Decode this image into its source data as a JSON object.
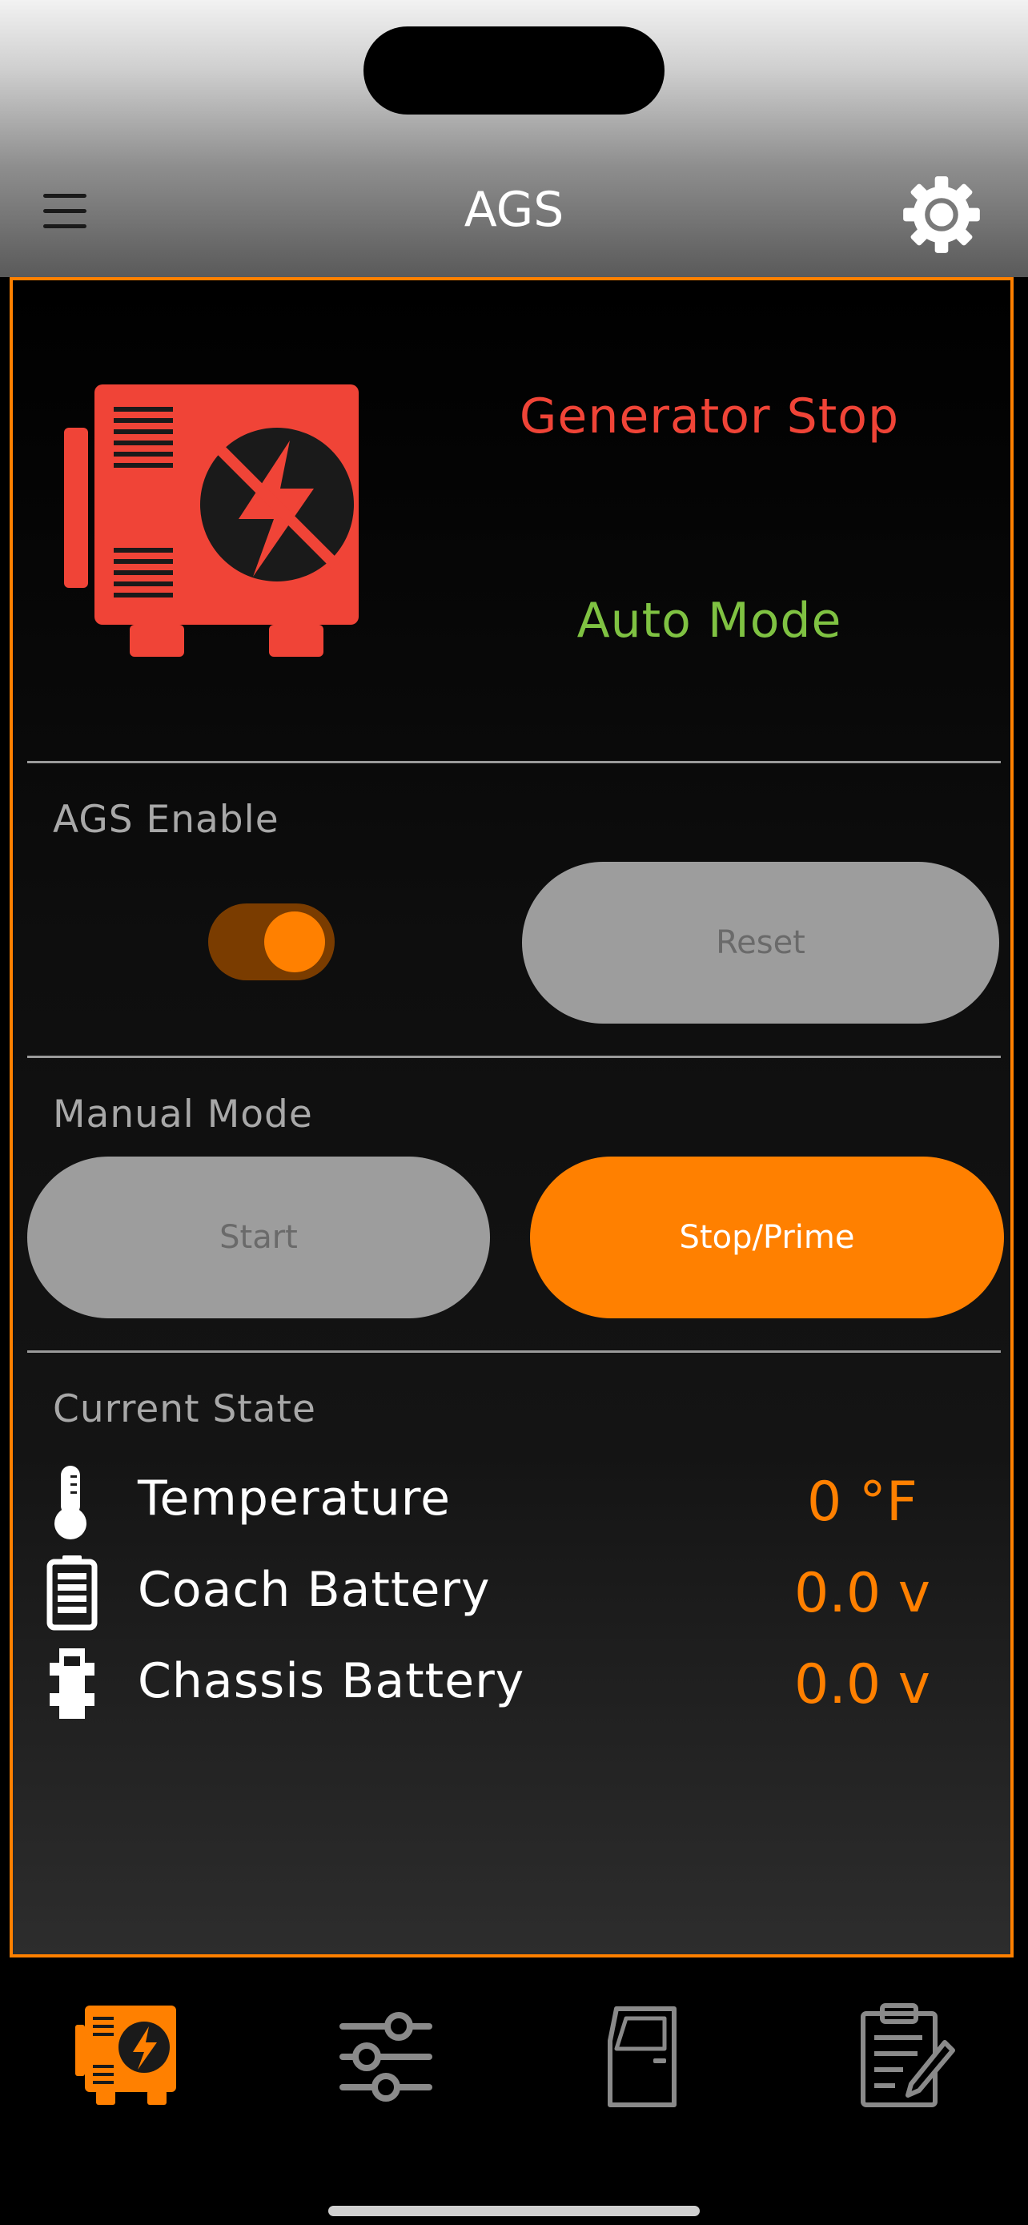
{
  "header": {
    "title": "AGS",
    "menu_icon": "hamburger-menu-icon",
    "settings_icon": "gear-icon"
  },
  "generator": {
    "status": "Generator Stop",
    "status_color": "#f04437",
    "mode": "Auto Mode",
    "mode_color": "#7fc242"
  },
  "ags_enable": {
    "label": "AGS Enable",
    "toggle_on": true,
    "reset_label": "Reset"
  },
  "manual_mode": {
    "label": "Manual Mode",
    "start_label": "Start",
    "stop_label": "Stop/Prime"
  },
  "current_state": {
    "label": "Current State",
    "rows": [
      {
        "icon": "thermometer-icon",
        "label": "Temperature",
        "value": "0 °F"
      },
      {
        "icon": "battery-icon",
        "label": "Coach Battery",
        "value": "0.0 v"
      },
      {
        "icon": "chassis-icon",
        "label": "Chassis Battery",
        "value": "0.0 v"
      }
    ]
  },
  "tabs": [
    {
      "icon": "generator-tab-icon",
      "active": true
    },
    {
      "icon": "sliders-icon",
      "active": false
    },
    {
      "icon": "door-icon",
      "active": false
    },
    {
      "icon": "clipboard-edit-icon",
      "active": false
    }
  ],
  "colors": {
    "accent": "#ff8000",
    "panel_border": "#ff8000"
  }
}
